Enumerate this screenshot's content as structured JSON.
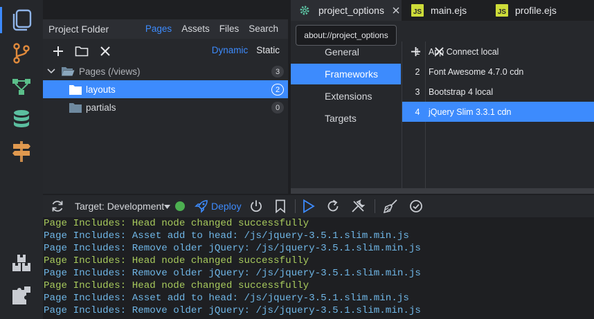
{
  "project_folder": {
    "title": "Project Folder",
    "tabs": [
      "Pages",
      "Assets",
      "Files",
      "Search"
    ],
    "active_tab": "Pages",
    "mode_options": [
      "Dynamic",
      "Static"
    ],
    "active_mode": "Dynamic",
    "tree": [
      {
        "label": "Pages (/views)",
        "count": "3",
        "expanded": true,
        "level": 0
      },
      {
        "label": "layouts",
        "count": "2",
        "selected": true,
        "level": 1
      },
      {
        "label": "partials",
        "count": "0",
        "level": 1
      }
    ]
  },
  "editor_tabs": [
    {
      "label": "project_options",
      "icon": "gear-icon",
      "active": true,
      "closable": true
    },
    {
      "label": "main.ejs",
      "icon": "js-file-icon",
      "badge": "JS"
    },
    {
      "label": "profile.ejs",
      "icon": "js-file-icon",
      "badge": "JS"
    }
  ],
  "tooltip": "about://project_options",
  "options": {
    "nav": [
      "General",
      "Frameworks",
      "Extensions",
      "Targets"
    ],
    "active_nav": "Frameworks",
    "libraries": [
      {
        "num": "1",
        "name": "App Connect local"
      },
      {
        "num": "2",
        "name": "Font Awesome 4.7.0 cdn"
      },
      {
        "num": "3",
        "name": "Bootstrap 4 local"
      },
      {
        "num": "4",
        "name": "jQuery Slim 3.3.1 cdn",
        "selected": true
      }
    ]
  },
  "toolbar": {
    "target_label": "Target:  Development",
    "status_color": "#4caf50",
    "deploy_label": "Deploy"
  },
  "console": [
    {
      "text": "Page Includes: Head node changed successfully",
      "kind": "green"
    },
    {
      "text": "Page Includes: Asset add to head: /js/jquery-3.5.1.slim.min.js",
      "kind": "blue"
    },
    {
      "text": "Page Includes: Remove older jQuery: /js/jquery-3.5.1.slim.min.js",
      "kind": "blue"
    },
    {
      "text": "Page Includes: Head node changed successfully",
      "kind": "green"
    },
    {
      "text": "Page Includes: Remove older jQuery: /js/jquery-3.5.1.slim.min.js",
      "kind": "blue"
    },
    {
      "text": "Page Includes: Head node changed successfully",
      "kind": "green"
    },
    {
      "text": "Page Includes: Asset add to head: /js/jquery-3.5.1.slim.min.js",
      "kind": "blue"
    },
    {
      "text": "Page Includes: Remove older jQuery: /js/jquery-3.5.1.slim.min.js",
      "kind": "blue"
    }
  ],
  "colors": {
    "accent": "#3d8bfd",
    "background": "#1e1f22",
    "panel": "#26282c",
    "log_green": "#a7c95c",
    "log_blue": "#6fb6e6"
  }
}
